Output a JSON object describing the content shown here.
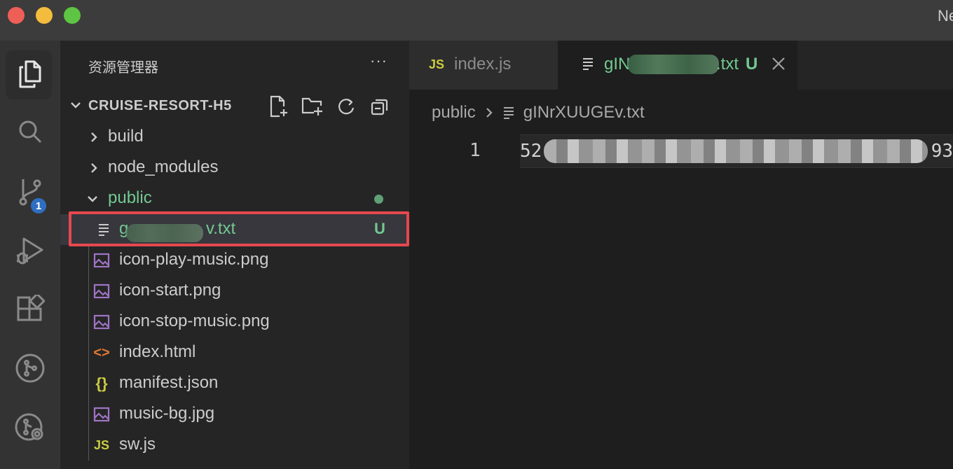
{
  "window": {
    "title": "Ne"
  },
  "activity": {
    "source_control_badge": "1"
  },
  "sidebar": {
    "title": "资源管理器",
    "more": "···",
    "project": "CRUISE-RESORT-H5",
    "folders": [
      {
        "label": "build"
      },
      {
        "label": "node_modules"
      },
      {
        "label": "public"
      }
    ],
    "selected_file": {
      "label_start": "g",
      "label_end": "v.txt",
      "status": "U"
    },
    "files": [
      {
        "label": "icon-play-music.png",
        "icon": "image-icon"
      },
      {
        "label": "icon-start.png",
        "icon": "image-icon"
      },
      {
        "label": "icon-stop-music.png",
        "icon": "image-icon"
      },
      {
        "label": "index.html",
        "icon": "html-icon",
        "glyph": "<>"
      },
      {
        "label": "manifest.json",
        "icon": "json-icon",
        "glyph": "{}"
      },
      {
        "label": "music-bg.jpg",
        "icon": "image-icon"
      },
      {
        "label": "sw.js",
        "icon": "js-icon",
        "glyph": "JS"
      }
    ]
  },
  "tabs": [
    {
      "label": "index.js",
      "icon_text": "JS"
    },
    {
      "label_start": "gIN",
      "label_end": ".txt",
      "status": "U"
    }
  ],
  "breadcrumb": {
    "folder": "public",
    "file": "gINrXUUGEv.txt"
  },
  "editor": {
    "line_number": "1",
    "text_start": "52",
    "text_end": "93"
  },
  "colors": {
    "git_untracked": "#73c991",
    "accent_badge": "#2f6ec0",
    "highlight": "#e5484d"
  }
}
